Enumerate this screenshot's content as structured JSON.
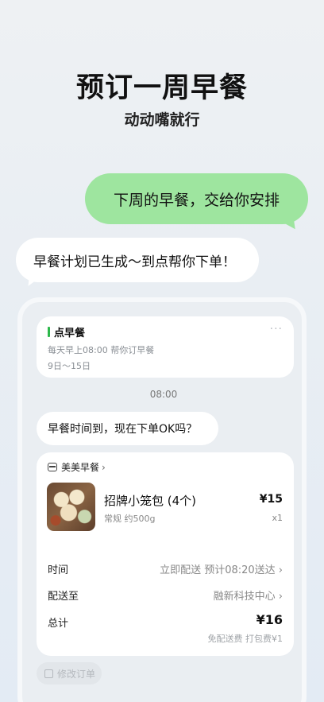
{
  "hero": {
    "title": "预订一周早餐",
    "subtitle": "动动嘴就行"
  },
  "chat": {
    "user_message": "下周的早餐，交给你安排",
    "bot_message": "早餐计划已生成～到点帮你下单！"
  },
  "plan_card": {
    "title": "点早餐",
    "more": "···",
    "schedule": "每天早上08:00 帮你订早餐",
    "date_range": "9日～15日"
  },
  "timestamp": "08:00",
  "reminder": "早餐时间到，现在下单OK吗？",
  "order_card": {
    "shop_name": "美美早餐",
    "shop_chevron": "›",
    "item": {
      "name": "招牌小笼包 (4个)",
      "spec": "常规 约500g",
      "price": "¥15",
      "qty": "x1"
    },
    "time_label": "时间",
    "time_value": "立即配送 预计08:20送达 ›",
    "address_label": "配送至",
    "address_value": "融新科技中心 ›",
    "total_label": "总计",
    "total_value": "¥16",
    "fee_note": "免配送费 打包费¥1"
  },
  "edit_button": "修改订单",
  "colors": {
    "user_bubble": "#9ee59f",
    "accent_bar": "#2db84b"
  }
}
